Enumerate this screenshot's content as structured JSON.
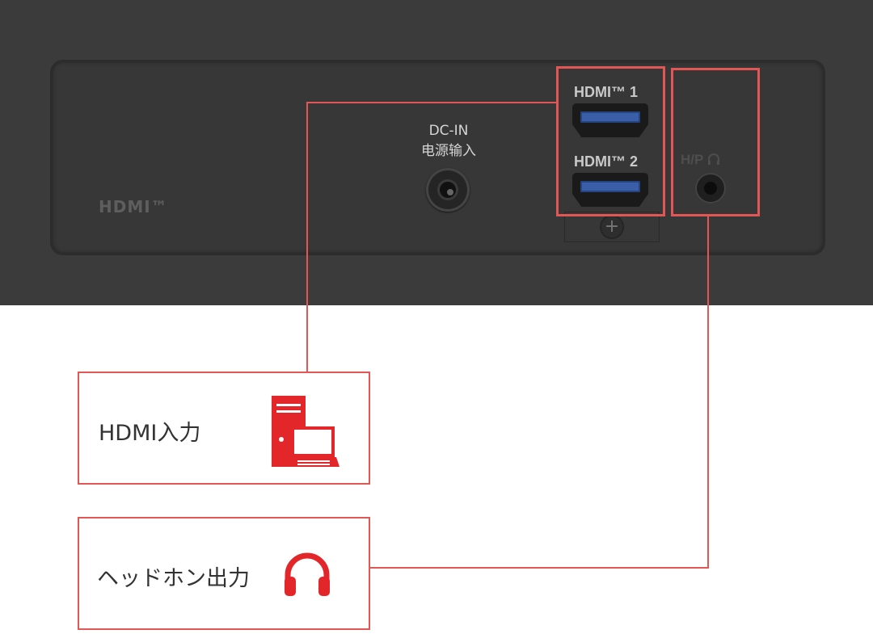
{
  "panel": {
    "hdmi_logo": "HDMI™",
    "dc_in_label": "DC-IN",
    "dc_in_label_cn": "电源输入",
    "hdmi1_label": "HDMI™ 1",
    "hdmi2_label": "HDMI™ 2",
    "headphone_port_label": "H/P"
  },
  "callouts": [
    {
      "label": "HDMI入力",
      "icon": "pc-laptop-icon"
    },
    {
      "label": "ヘッドホン出力",
      "icon": "headphones-icon"
    }
  ],
  "colors": {
    "highlight": "#e25656",
    "icon_red": "#e3262a",
    "panel": "#3b3b3b",
    "hdmi_slot": "#3a5fa8"
  }
}
